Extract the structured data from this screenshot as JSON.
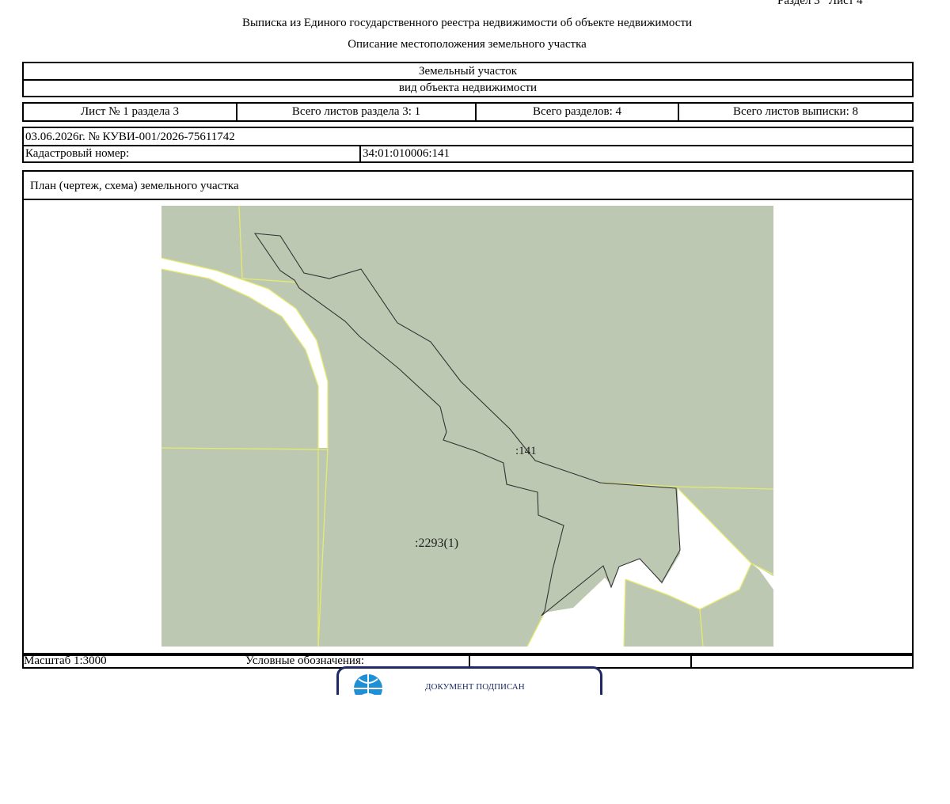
{
  "header": {
    "page_ref": "Раздел 3   Лист 4",
    "title": "Выписка из Единого государственного реестра недвижимости об объекте недвижимости",
    "subtitle": "Описание местоположения земельного участка"
  },
  "object": {
    "type": "Земельный участок",
    "type_caption": "вид объекта недвижимости"
  },
  "sheets": {
    "sheet": "Лист № 1 раздела 3",
    "total_section_sheets": "Всего листов раздела 3: 1",
    "total_sections": "Всего разделов: 4",
    "total_extract_sheets": "Всего листов выписки: 8"
  },
  "record": {
    "date_number": "03.06.2026г. № КУВИ-001/2026-75611742",
    "cadastral_label": "Кадастровый номер:",
    "cadastral_value": "34:01:010006:141"
  },
  "plan": {
    "heading": "План (чертеж, схема) земельного участка",
    "label_main": ":141",
    "label_neighbor": ":2293(1)",
    "colors": {
      "parcel_fill": "#bdc8b2",
      "road": "#ffffff",
      "boundary": "#e6ea70",
      "outline": "#333333"
    }
  },
  "footer": {
    "scale": "Масштаб 1:3000",
    "legend_label": "Условные обозначения:",
    "legend_col3": "",
    "legend_col4": ""
  },
  "stamp": {
    "text": "ДОКУМЕНТ ПОДПИСАН",
    "emblem_icon": "globe-emblem-icon"
  }
}
